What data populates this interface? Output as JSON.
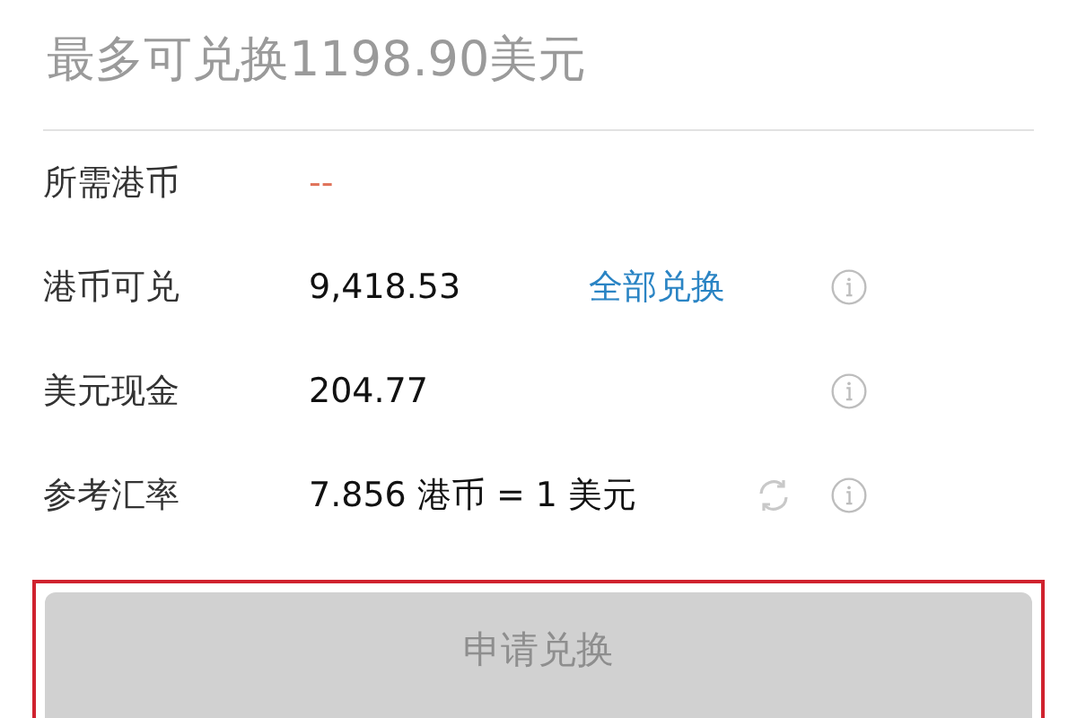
{
  "max_exchange": "最多可兑换1198.90美元",
  "rows": [
    {
      "label": "所需港币",
      "value": "--",
      "kind": "empty",
      "info": false,
      "refresh": false
    },
    {
      "label": "港币可兑",
      "value": "9,418.53",
      "kind": "amount",
      "link": "全部兑换",
      "info": true,
      "refresh": false
    },
    {
      "label": "美元现金",
      "value": "204.77",
      "kind": "amount",
      "info": true,
      "refresh": false
    },
    {
      "label": "参考汇率",
      "value": "7.856 港币 = 1 美元",
      "kind": "amount",
      "info": true,
      "refresh": true
    }
  ],
  "submit": {
    "label": "申请兑换",
    "disabled": true,
    "highlighted": true
  }
}
